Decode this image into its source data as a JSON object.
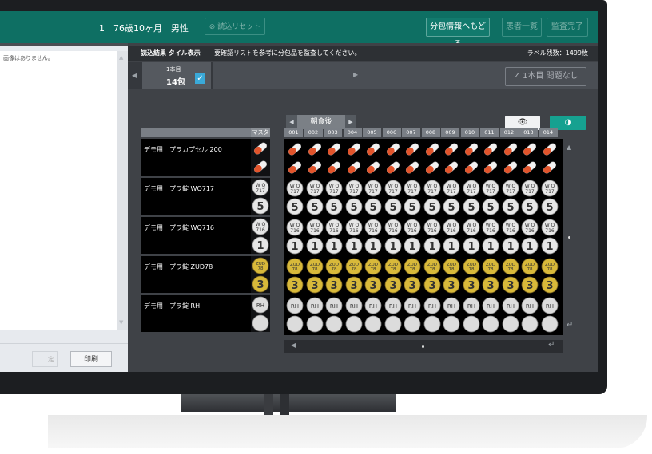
{
  "header": {
    "patient_info": "1　76歳10ヶ月　男性",
    "reset_label": "読込リセット",
    "goto_pack_label": "分包情報へもどる",
    "patient_list_label": "患者一覧",
    "audit_done_label": "監査完了"
  },
  "left_panel": {
    "message": "画像はありません。",
    "clipped_button_label": "定",
    "print_label": "印刷"
  },
  "info_bar": {
    "mode": "読込結果 タイル表示",
    "instruction": "要確認リストを参考に分包品を監査してください。",
    "label_count": "ラベル残数：1499枚"
  },
  "tab": {
    "line1": "1本目",
    "line2": "14包",
    "no_problem_label": "1本目 問題なし"
  },
  "time_selector": {
    "label": "朝食後"
  },
  "table": {
    "master_header": "マスタ",
    "columns": [
      "001",
      "002",
      "003",
      "004",
      "005",
      "006",
      "007",
      "008",
      "009",
      "010",
      "011",
      "012",
      "013",
      "014"
    ],
    "drugs": [
      {
        "name": "デモ用　プラカプセル 200",
        "type": "capsule"
      },
      {
        "name": "デモ用　プラ錠 WQ717",
        "type": "wq",
        "code": "717",
        "digit": "5"
      },
      {
        "name": "デモ用　プラ錠 WQ716",
        "type": "wq",
        "code": "716",
        "digit": "1"
      },
      {
        "name": "デモ用　プラ錠 ZUD78",
        "type": "zud",
        "digit": "3"
      },
      {
        "name": "デモ用　プラ錠 RH",
        "type": "rh"
      }
    ]
  },
  "colors": {
    "header_green": "#0e6f63",
    "capsule_orange": "#e2542b",
    "zud_gold": "#d8b93a",
    "check_blue": "#3aa9d8",
    "contrast_teal": "#16a190"
  },
  "icons": [
    "prohibit-icon",
    "check-icon",
    "eye-icon",
    "contrast-icon",
    "arrow-left-icon",
    "arrow-right-icon",
    "scroll-up-icon",
    "scroll-down-icon",
    "return-icon"
  ]
}
